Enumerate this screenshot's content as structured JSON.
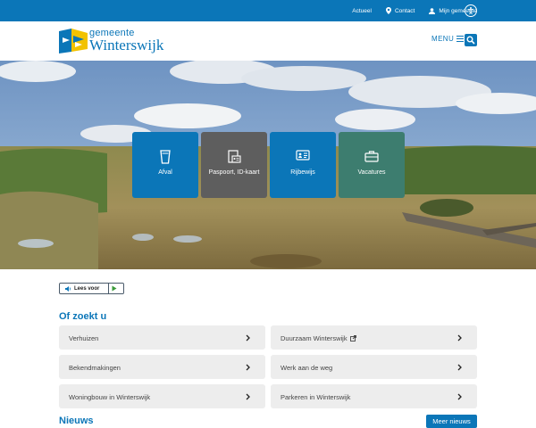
{
  "topbar": {
    "links": [
      {
        "label": "Actueel",
        "icon": ""
      },
      {
        "label": "Contact",
        "icon": "location-pin-icon"
      },
      {
        "label": "Mijn gemeente",
        "icon": "user-icon"
      }
    ],
    "accessibility_icon": "accessibility-icon",
    "color": "#0b76b8"
  },
  "header": {
    "logo_line1": "gemeente",
    "logo_line2": "Winterswijk",
    "menu_label": "MENU"
  },
  "tiles": [
    {
      "label": "Afval",
      "icon": "trash-bin-icon",
      "color": "#0b76b8"
    },
    {
      "label": "Paspoort, ID-kaart",
      "icon": "id-document-icon",
      "color": "#5e5e5e"
    },
    {
      "label": "Rijbewijs",
      "icon": "drivers-license-icon",
      "color": "#0b76b8"
    },
    {
      "label": "Vacatures",
      "icon": "briefcase-icon",
      "color": "#3d7d6f"
    }
  ],
  "readspeaker": {
    "label": "Lees voor"
  },
  "quicklinks": {
    "title": "Of zoekt u",
    "items": [
      {
        "label": "Verhuizen",
        "external": false
      },
      {
        "label": "Duurzaam Winterswijk",
        "external": true
      },
      {
        "label": "Bekendmakingen",
        "external": false
      },
      {
        "label": "Werk aan de weg",
        "external": false
      },
      {
        "label": "Woningbouw in Winterswijk",
        "external": false
      },
      {
        "label": "Parkeren in Winterswijk",
        "external": false
      }
    ]
  },
  "news": {
    "title": "Nieuws",
    "more_label": "Meer nieuws"
  }
}
